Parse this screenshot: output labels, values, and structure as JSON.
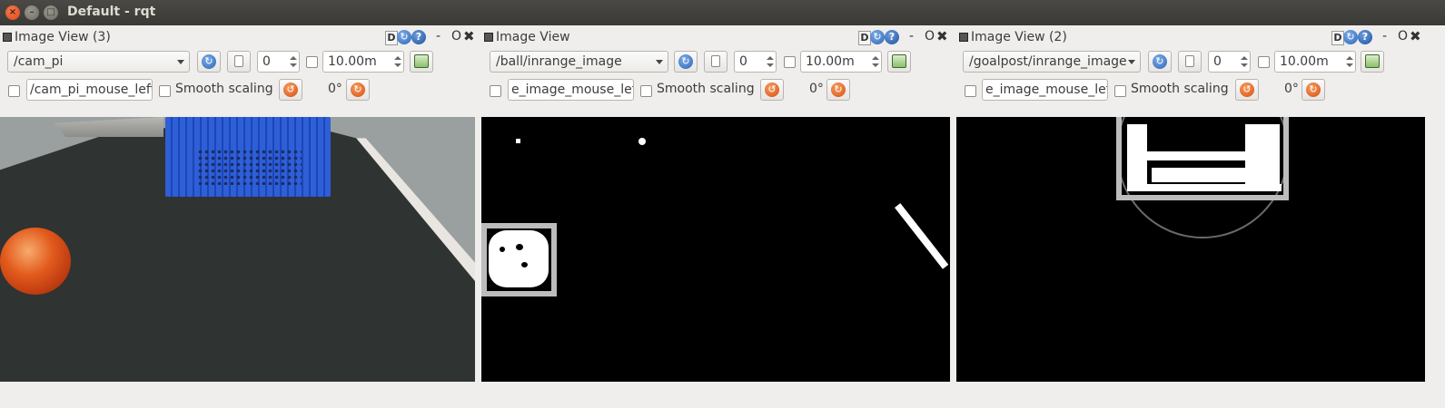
{
  "window": {
    "title": "Default - rqt",
    "close_glyph": "×",
    "min_glyph": "–",
    "max_glyph": "□"
  },
  "panels": [
    {
      "title": "Image View (3)",
      "topic": "/cam_pi",
      "zoom_value": "0",
      "max_range": "10.00m",
      "mouse_topic": "/cam_pi_mouse_left",
      "smooth_label": "Smooth scaling",
      "rotation": "0°"
    },
    {
      "title": "Image View",
      "topic": "/ball/inrange_image",
      "zoom_value": "0",
      "max_range": "10.00m",
      "mouse_topic": "e_image_mouse_left",
      "smooth_label": "Smooth scaling",
      "rotation": "0°"
    },
    {
      "title": "Image View (2)",
      "topic": "/goalpost/inrange_image",
      "zoom_value": "0",
      "max_range": "10.00m",
      "mouse_topic": "e_image_mouse_left",
      "smooth_label": "Smooth scaling",
      "rotation": "0°"
    }
  ],
  "header_icons": {
    "d_label": "D",
    "refresh_glyph": "↻",
    "help_glyph": "?",
    "minimize_glyph": "-",
    "float_glyph": "O",
    "close_glyph": "✖"
  },
  "toolbar_glyphs": {
    "refresh": "↻",
    "rotate_left": "↺",
    "rotate_right": "↻"
  },
  "colors": {
    "window_bg": "#efeeec",
    "titlebar": "#3c3b37",
    "accent_close": "#dd4814"
  }
}
